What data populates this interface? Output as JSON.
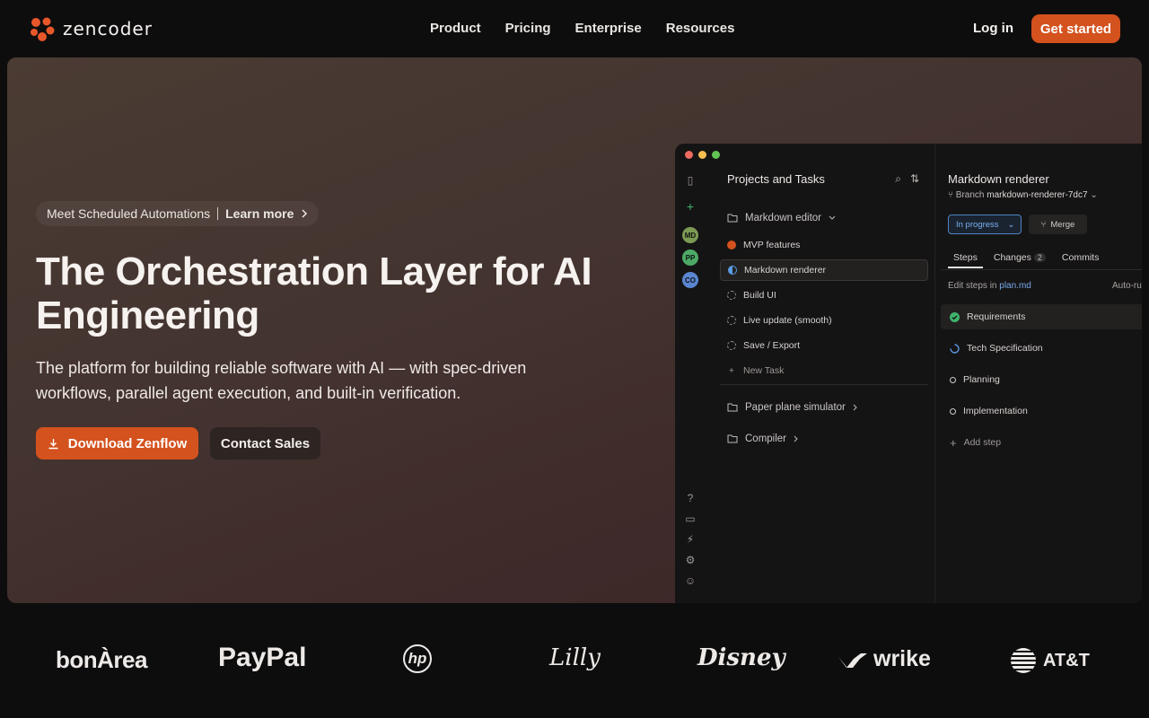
{
  "brand": {
    "name": "zencoder"
  },
  "nav": {
    "links": [
      "Product",
      "Pricing",
      "Enterprise",
      "Resources"
    ],
    "login": "Log in",
    "cta": "Get started"
  },
  "hero": {
    "announcement": {
      "text": "Meet Scheduled Automations",
      "link": "Learn more"
    },
    "title": "The Orchestration Layer for AI Engineering",
    "subtitle": "The platform for building reliable software with AI — with spec-driven workflows, parallel agent execution, and built-in verification.",
    "primary_button": "Download Zenflow",
    "secondary_button": "Contact Sales"
  },
  "app": {
    "avatars": [
      "MD",
      "PP",
      "CO"
    ],
    "projects_title": "Projects and Tasks",
    "folder_open": "Markdown editor",
    "tasks": [
      "MVP features",
      "Markdown renderer",
      "Build UI",
      "Live update (smooth)",
      "Save / Export"
    ],
    "new_task": "New Task",
    "folders": [
      "Paper plane simulator",
      "Compiler"
    ],
    "detail": {
      "title": "Markdown renderer",
      "branch_label": "Branch",
      "branch": "markdown-renderer-7dc7",
      "status": "In progress",
      "merge": "Merge",
      "tabs": [
        "Steps",
        "Changes",
        "Commits"
      ],
      "changes_count": "2",
      "edit_prefix": "Edit steps in",
      "edit_link": "plan.md",
      "autorun": "Auto-run",
      "steps": [
        "Requirements",
        "Tech Specification",
        "Planning",
        "Implementation"
      ],
      "step_in": "In",
      "add_step": "Add step"
    }
  },
  "logos": [
    "bonÀrea",
    "PayPal",
    "hp",
    "Lilly",
    "Disney",
    "wrike",
    "AT&T"
  ],
  "colors": {
    "accent": "#d4521e",
    "status_blue": "#4f84c4",
    "success_green": "#3fb36c"
  }
}
